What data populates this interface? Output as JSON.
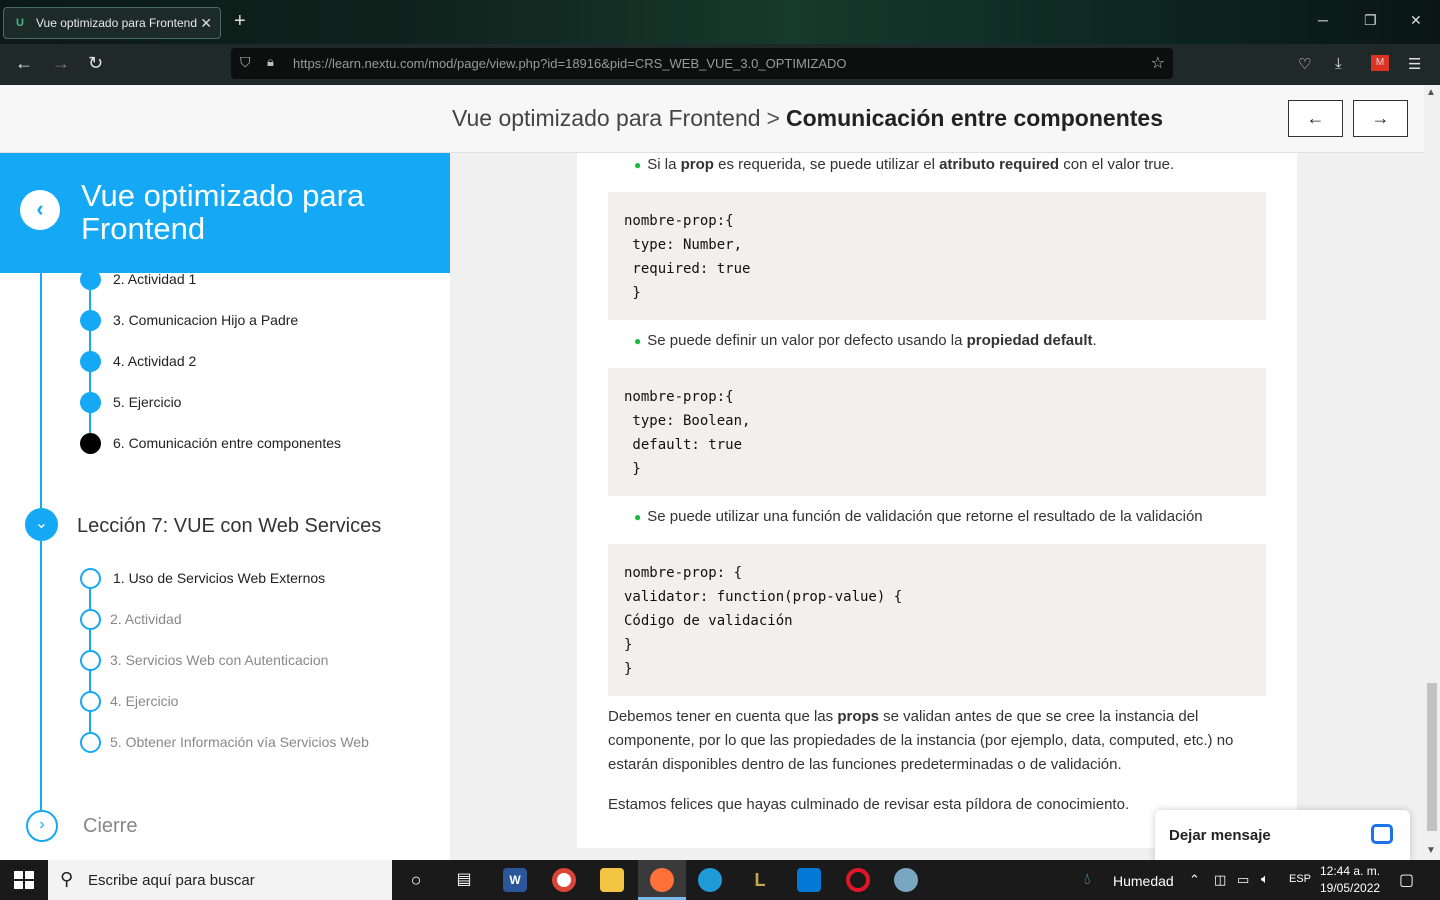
{
  "browser": {
    "tab_title": "Vue optimizado para Frontend",
    "url": "https://learn.nextu.com/mod/page/view.php?id=18916&pid=CRS_WEB_VUE_3.0_OPTIMIZADO"
  },
  "header": {
    "breadcrumb_course": "Vue optimizado para Frontend",
    "breadcrumb_sep": ">",
    "breadcrumb_page": "Comunicación entre componentes",
    "prev_label": "←",
    "next_label": "→"
  },
  "sidebar": {
    "course_title": "Vue optimizado para Frontend",
    "prev_items": [
      {
        "label": "2. Actividad 1"
      },
      {
        "label": "3. Comunicacion Hijo a Padre"
      },
      {
        "label": "4. Actividad 2"
      },
      {
        "label": "5. Ejercicio"
      },
      {
        "label": "6. Comunicación entre componentes"
      }
    ],
    "lesson_title": "Lección 7: VUE con Web Services",
    "lesson_items": [
      {
        "label": "1. Uso de Servicios Web Externos"
      },
      {
        "label": "2. Actividad"
      },
      {
        "label": "3. Servicios Web con Autenticacion"
      },
      {
        "label": "4. Ejercicio"
      },
      {
        "label": "5. Obtener Información vía Servicios Web"
      }
    ],
    "cierre_label": "Cierre"
  },
  "content": {
    "bullet1": {
      "t1": "Si la ",
      "b1": "prop",
      "t2": " es requerida, se puede utilizar el ",
      "b2": "atributo required",
      "t3": " con  el valor true."
    },
    "code1": "nombre-prop:{\n type: Number,\n required: true\n }",
    "bullet2": {
      "t1": "Se puede definir un valor por defecto usando la ",
      "b1": "propiedad default",
      "t2": "."
    },
    "code2": "nombre-prop:{\n type: Boolean,\n default: true\n }",
    "bullet3": "Se puede utilizar una función de validación que retorne el resultado de la validación",
    "code3": "nombre-prop: {\nvalidator: function(prop-value) {\nCódigo de validación\n}\n}",
    "para1": {
      "t1": "Debemos tener en cuenta que las ",
      "b1": "props",
      "t2": " se validan antes de que se cree la instancia del componente, por lo que las propiedades de la instancia (por ejemplo, data, computed, etc.) no estarán disponibles dentro de las funciones predeterminadas o de validación."
    },
    "para2": "Estamos felices que hayas culminado de revisar esta píldora de conocimiento."
  },
  "chat": {
    "label": "Dejar mensaje"
  },
  "taskbar": {
    "search_placeholder": "Escribe aquí para buscar",
    "weather": "Humedad",
    "lang": "ESP",
    "time": "12:44 a. m.",
    "date": "19/05/2022"
  },
  "colors": {
    "accent": "#14a8f5",
    "bullet": "#1abc3c"
  }
}
